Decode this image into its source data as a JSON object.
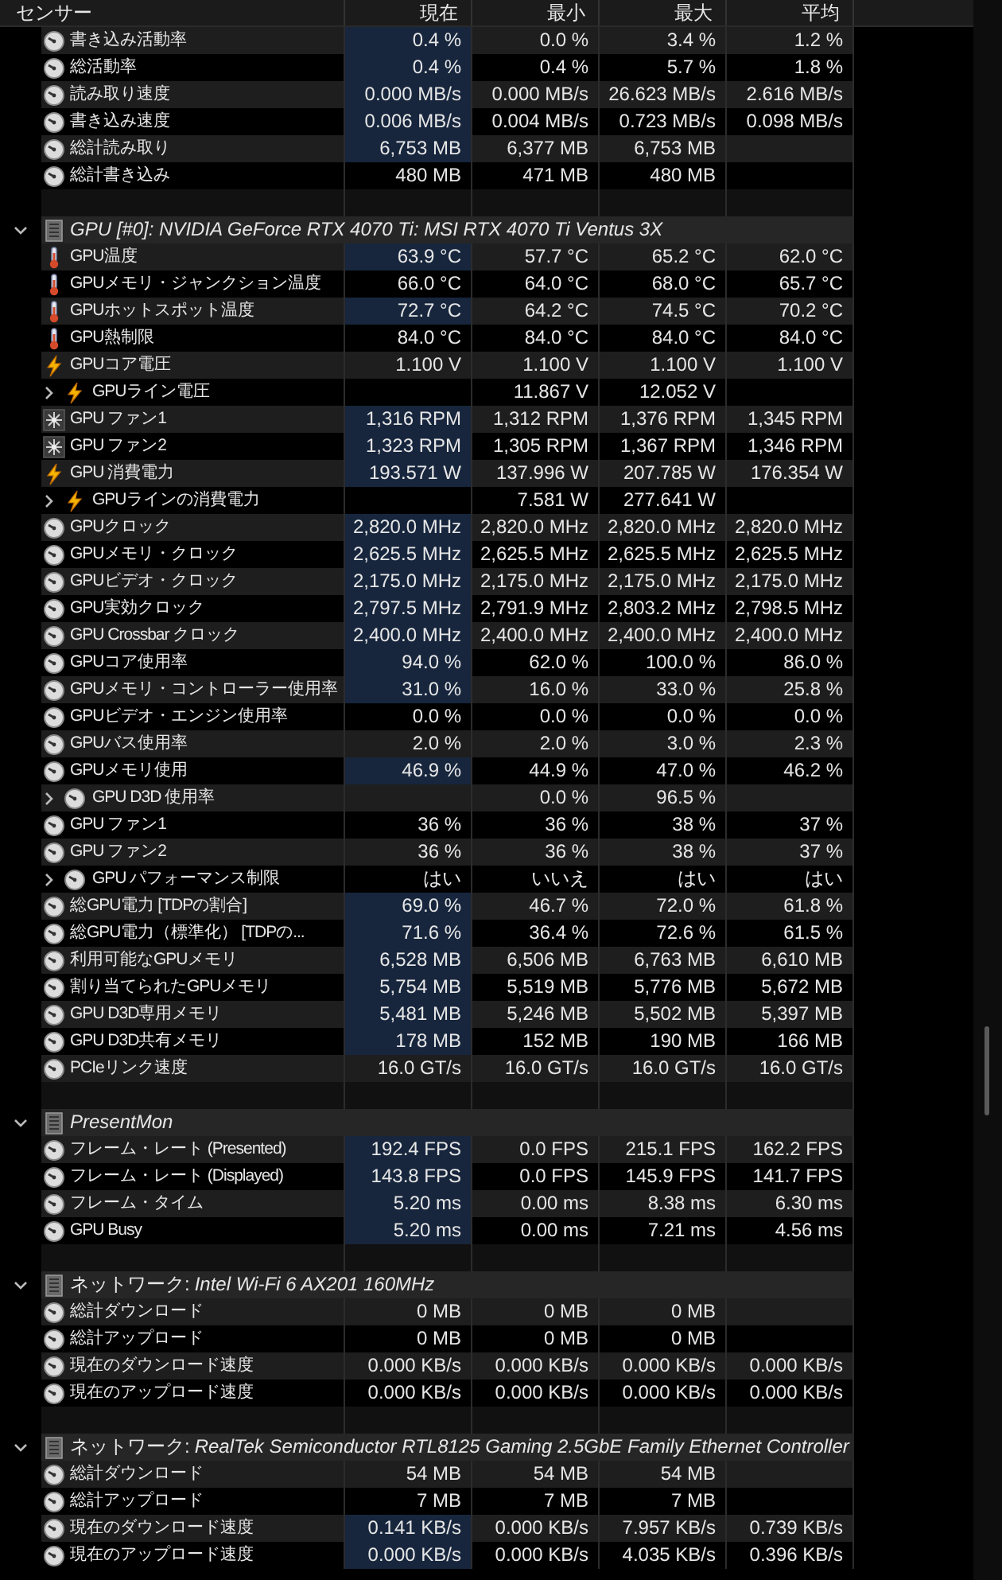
{
  "columns": [
    "センサー",
    "現在",
    "最小",
    "最大",
    "平均"
  ],
  "sections": [
    {
      "rows": [
        {
          "name": "書き込み活動率",
          "kind": "gauge",
          "current": "0.4 %",
          "min": "0.0 %",
          "max": "3.4 %",
          "avg": "1.2 %",
          "highlight": true
        },
        {
          "name": "総活動率",
          "kind": "gauge",
          "current": "0.4 %",
          "min": "0.4 %",
          "max": "5.7 %",
          "avg": "1.8 %",
          "highlight": true
        },
        {
          "name": "読み取り速度",
          "kind": "gauge",
          "current": "0.000 MB/s",
          "min": "0.000 MB/s",
          "max": "26.623 MB/s",
          "avg": "2.616 MB/s",
          "highlight": true
        },
        {
          "name": "書き込み速度",
          "kind": "gauge",
          "current": "0.006 MB/s",
          "min": "0.004 MB/s",
          "max": "0.723 MB/s",
          "avg": "0.098 MB/s",
          "highlight": true
        },
        {
          "name": "総計読み取り",
          "kind": "gauge",
          "current": "6,753 MB",
          "min": "6,377 MB",
          "max": "6,753 MB",
          "highlight": true
        },
        {
          "name": "総計書き込み",
          "kind": "gauge",
          "current": "480 MB",
          "min": "471 MB",
          "max": "480 MB",
          "highlight": false
        }
      ]
    },
    {
      "title": "GPU [#0]: NVIDIA GeForce RTX 4070 Ti: MSI RTX 4070 Ti Ventus 3X",
      "expanded": true,
      "rows": [
        {
          "name": "GPU温度",
          "kind": "thermometer",
          "current": "63.9 °C",
          "min": "57.7 °C",
          "max": "65.2 °C",
          "avg": "62.0 °C",
          "highlight": true
        },
        {
          "name": "GPUメモリ・ジャンクション温度",
          "kind": "thermometer",
          "current": "66.0 °C",
          "min": "64.0 °C",
          "max": "68.0 °C",
          "avg": "65.7 °C",
          "highlight": false
        },
        {
          "name": "GPUホットスポット温度",
          "kind": "thermometer",
          "current": "72.7 °C",
          "min": "64.2 °C",
          "max": "74.5 °C",
          "avg": "70.2 °C",
          "highlight": true
        },
        {
          "name": "GPU熱制限",
          "kind": "thermometer",
          "current": "84.0 °C",
          "min": "84.0 °C",
          "max": "84.0 °C",
          "avg": "84.0 °C",
          "highlight": false
        },
        {
          "name": "GPUコア電圧",
          "kind": "bolt",
          "current": "1.100 V",
          "min": "1.100 V",
          "max": "1.100 V",
          "avg": "1.100 V",
          "highlight": false
        },
        {
          "name": "GPUライン電圧",
          "kind": "bolt",
          "expanded": false,
          "min": "11.867 V",
          "max": "12.052 V",
          "highlight": false
        },
        {
          "name": "GPU ファン1",
          "kind": "fan",
          "current": "1,316 RPM",
          "min": "1,312 RPM",
          "max": "1,376 RPM",
          "avg": "1,345 RPM",
          "highlight": true
        },
        {
          "name": "GPU ファン2",
          "kind": "fan",
          "current": "1,323 RPM",
          "min": "1,305 RPM",
          "max": "1,367 RPM",
          "avg": "1,346 RPM",
          "highlight": true
        },
        {
          "name": "GPU 消費電力",
          "kind": "bolt",
          "current": "193.571 W",
          "min": "137.996 W",
          "max": "207.785 W",
          "avg": "176.354 W",
          "highlight": true
        },
        {
          "name": "GPUラインの消費電力",
          "kind": "bolt",
          "expanded": false,
          "min": "7.581 W",
          "max": "277.641 W",
          "highlight": false
        },
        {
          "name": "GPUクロック",
          "kind": "gauge",
          "current": "2,820.0 MHz",
          "min": "2,820.0 MHz",
          "max": "2,820.0 MHz",
          "avg": "2,820.0 MHz",
          "highlight": true
        },
        {
          "name": "GPUメモリ・クロック",
          "kind": "gauge",
          "current": "2,625.5 MHz",
          "min": "2,625.5 MHz",
          "max": "2,625.5 MHz",
          "avg": "2,625.5 MHz",
          "highlight": true
        },
        {
          "name": "GPUビデオ・クロック",
          "kind": "gauge",
          "current": "2,175.0 MHz",
          "min": "2,175.0 MHz",
          "max": "2,175.0 MHz",
          "avg": "2,175.0 MHz",
          "highlight": true
        },
        {
          "name": "GPU実効クロック",
          "kind": "gauge",
          "current": "2,797.5 MHz",
          "min": "2,791.9 MHz",
          "max": "2,803.2 MHz",
          "avg": "2,798.5 MHz",
          "highlight": true
        },
        {
          "name": "GPU Crossbar クロック",
          "kind": "gauge",
          "current": "2,400.0 MHz",
          "min": "2,400.0 MHz",
          "max": "2,400.0 MHz",
          "avg": "2,400.0 MHz",
          "highlight": true
        },
        {
          "name": "GPUコア使用率",
          "kind": "gauge",
          "current": "94.0 %",
          "min": "62.0 %",
          "max": "100.0 %",
          "avg": "86.0 %",
          "highlight": true
        },
        {
          "name": "GPUメモリ・コントローラー使用率",
          "kind": "gauge",
          "current": "31.0 %",
          "min": "16.0 %",
          "max": "33.0 %",
          "avg": "25.8 %",
          "highlight": true
        },
        {
          "name": "GPUビデオ・エンジン使用率",
          "kind": "gauge",
          "current": "0.0 %",
          "min": "0.0 %",
          "max": "0.0 %",
          "avg": "0.0 %",
          "highlight": false
        },
        {
          "name": "GPUバス使用率",
          "kind": "gauge",
          "current": "2.0 %",
          "min": "2.0 %",
          "max": "3.0 %",
          "avg": "2.3 %",
          "highlight": false
        },
        {
          "name": "GPUメモリ使用",
          "kind": "gauge",
          "current": "46.9 %",
          "min": "44.9 %",
          "max": "47.0 %",
          "avg": "46.2 %",
          "highlight": true
        },
        {
          "name": "GPU D3D 使用率",
          "kind": "gauge",
          "expanded": false,
          "min": "0.0 %",
          "max": "96.5 %",
          "highlight": false
        },
        {
          "name": "GPU ファン1",
          "kind": "gauge",
          "current": "36 %",
          "min": "36 %",
          "max": "38 %",
          "avg": "37 %",
          "highlight": false
        },
        {
          "name": "GPU ファン2",
          "kind": "gauge",
          "current": "36 %",
          "min": "36 %",
          "max": "38 %",
          "avg": "37 %",
          "highlight": false
        },
        {
          "name": "GPU パフォーマンス制限",
          "kind": "gauge",
          "expanded": false,
          "current": "はい",
          "min": "いいえ",
          "max": "はい",
          "avg": "はい",
          "highlight": false
        },
        {
          "name": "総GPU電力 [TDPの割合]",
          "kind": "gauge",
          "current": "69.0 %",
          "min": "46.7 %",
          "max": "72.0 %",
          "avg": "61.8 %",
          "highlight": true
        },
        {
          "name": "総GPU電力（標準化） [TDPの...",
          "kind": "gauge",
          "current": "71.6 %",
          "min": "36.4 %",
          "max": "72.6 %",
          "avg": "61.5 %",
          "highlight": true
        },
        {
          "name": "利用可能なGPUメモリ",
          "kind": "gauge",
          "current": "6,528 MB",
          "min": "6,506 MB",
          "max": "6,763 MB",
          "avg": "6,610 MB",
          "highlight": true
        },
        {
          "name": "割り当てられたGPUメモリ",
          "kind": "gauge",
          "current": "5,754 MB",
          "min": "5,519 MB",
          "max": "5,776 MB",
          "avg": "5,672 MB",
          "highlight": true
        },
        {
          "name": "GPU D3D専用メモリ",
          "kind": "gauge",
          "current": "5,481 MB",
          "min": "5,246 MB",
          "max": "5,502 MB",
          "avg": "5,397 MB",
          "highlight": true
        },
        {
          "name": "GPU D3D共有メモリ",
          "kind": "gauge",
          "current": "178 MB",
          "min": "152 MB",
          "max": "190 MB",
          "avg": "166 MB",
          "highlight": true
        },
        {
          "name": "PCIeリンク速度",
          "kind": "gauge",
          "current": "16.0 GT/s",
          "min": "16.0 GT/s",
          "max": "16.0 GT/s",
          "avg": "16.0 GT/s",
          "highlight": false
        }
      ]
    },
    {
      "title": "PresentMon",
      "expanded": true,
      "rows": [
        {
          "name": "フレーム・レート (Presented)",
          "kind": "gauge",
          "current": "192.4 FPS",
          "min": "0.0 FPS",
          "max": "215.1 FPS",
          "avg": "162.2 FPS",
          "highlight": true
        },
        {
          "name": "フレーム・レート (Displayed)",
          "kind": "gauge",
          "current": "143.8 FPS",
          "min": "0.0 FPS",
          "max": "145.9 FPS",
          "avg": "141.7 FPS",
          "highlight": true
        },
        {
          "name": "フレーム・タイム",
          "kind": "gauge",
          "current": "5.20 ms",
          "min": "0.00 ms",
          "max": "8.38 ms",
          "avg": "6.30 ms",
          "highlight": true
        },
        {
          "name": "GPU Busy",
          "kind": "gauge",
          "current": "5.20 ms",
          "min": "0.00 ms",
          "max": "7.21 ms",
          "avg": "4.56 ms",
          "highlight": true
        }
      ]
    },
    {
      "prefix": "ネットワーク:",
      "title": "Intel Wi-Fi 6 AX201 160MHz",
      "expanded": true,
      "rows": [
        {
          "name": "総計ダウンロード",
          "kind": "gauge",
          "current": "0 MB",
          "min": "0 MB",
          "max": "0 MB",
          "highlight": false
        },
        {
          "name": "総計アップロード",
          "kind": "gauge",
          "current": "0 MB",
          "min": "0 MB",
          "max": "0 MB",
          "highlight": false
        },
        {
          "name": "現在のダウンロード速度",
          "kind": "gauge",
          "current": "0.000 KB/s",
          "min": "0.000 KB/s",
          "max": "0.000 KB/s",
          "avg": "0.000 KB/s",
          "highlight": false
        },
        {
          "name": "現在のアップロード速度",
          "kind": "gauge",
          "current": "0.000 KB/s",
          "min": "0.000 KB/s",
          "max": "0.000 KB/s",
          "avg": "0.000 KB/s",
          "highlight": false
        }
      ]
    },
    {
      "prefix": "ネットワーク:",
      "title": "RealTek Semiconductor RTL8125 Gaming 2.5GbE Family Ethernet Controller",
      "expanded": true,
      "rows": [
        {
          "name": "総計ダウンロード",
          "kind": "gauge",
          "current": "54 MB",
          "min": "54 MB",
          "max": "54 MB",
          "highlight": false
        },
        {
          "name": "総計アップロード",
          "kind": "gauge",
          "current": "7 MB",
          "min": "7 MB",
          "max": "7 MB",
          "highlight": false
        },
        {
          "name": "現在のダウンロード速度",
          "kind": "gauge",
          "current": "0.141 KB/s",
          "min": "0.000 KB/s",
          "max": "7.957 KB/s",
          "avg": "0.739 KB/s",
          "highlight": true
        },
        {
          "name": "現在のアップロード速度",
          "kind": "gauge",
          "current": "0.000 KB/s",
          "min": "0.000 KB/s",
          "max": "4.035 KB/s",
          "avg": "0.396 KB/s",
          "highlight": true
        }
      ]
    }
  ]
}
